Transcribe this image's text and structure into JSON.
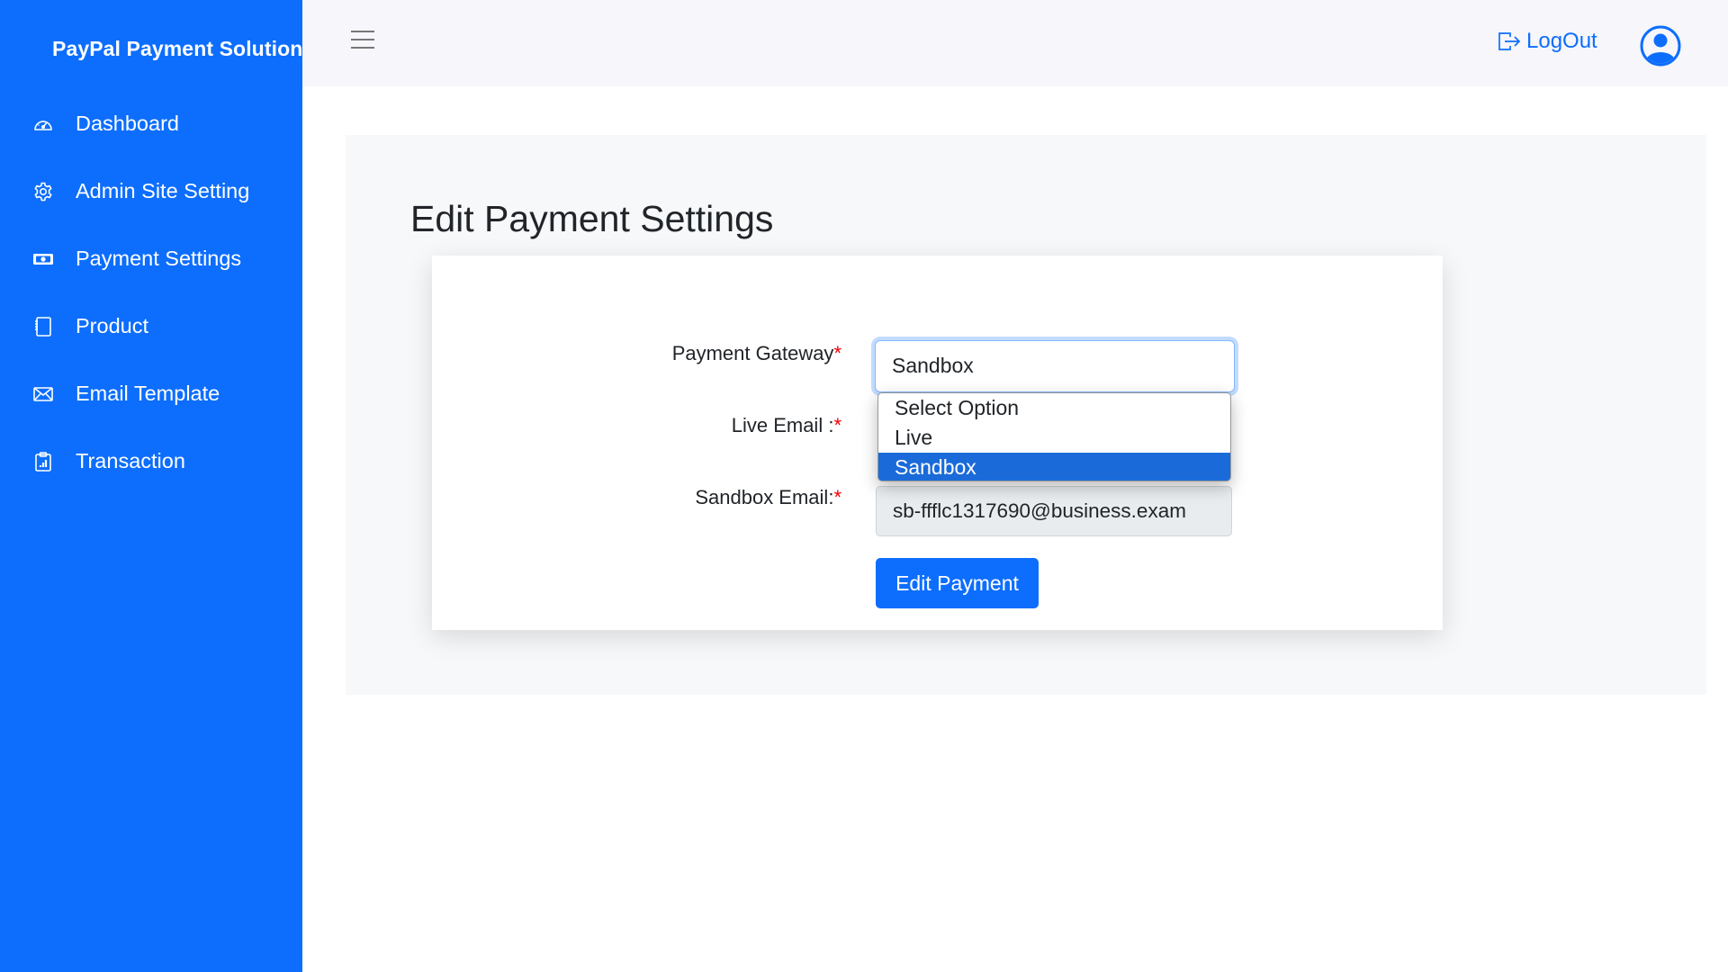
{
  "brand": {
    "title": "PayPal Payment Solution",
    "icon": "paypal-icon"
  },
  "sidebar": {
    "items": [
      {
        "label": "Dashboard",
        "icon": "speedometer-icon"
      },
      {
        "label": "Admin Site Setting",
        "icon": "gear-icon"
      },
      {
        "label": "Payment Settings",
        "icon": "cash-icon"
      },
      {
        "label": "Product",
        "icon": "notebook-icon"
      },
      {
        "label": "Email Template",
        "icon": "envelope-icon"
      },
      {
        "label": "Transaction",
        "icon": "clipboard-chart-icon"
      }
    ]
  },
  "header": {
    "menu_icon": "hamburger-icon",
    "logout_label": "LogOut",
    "logout_icon": "box-arrow-right-icon",
    "profile_icon": "person-circle-icon"
  },
  "page": {
    "title": "Edit Payment Settings",
    "form": {
      "gateway_label": "Payment Gateway",
      "live_email_label": "Live Email :",
      "sandbox_email_label": "Sandbox Email:",
      "required_mark": "*",
      "gateway_value": "Sandbox",
      "gateway_options": [
        "Select Option",
        "Live",
        "Sandbox"
      ],
      "gateway_highlighted": "Sandbox",
      "sandbox_email_value": "sb-ffflc1317690@business.exam",
      "submit_label": "Edit Payment"
    }
  },
  "colors": {
    "primary": "#0d6efd",
    "required": "#ee0000",
    "highlight": "#1a6bd9"
  }
}
